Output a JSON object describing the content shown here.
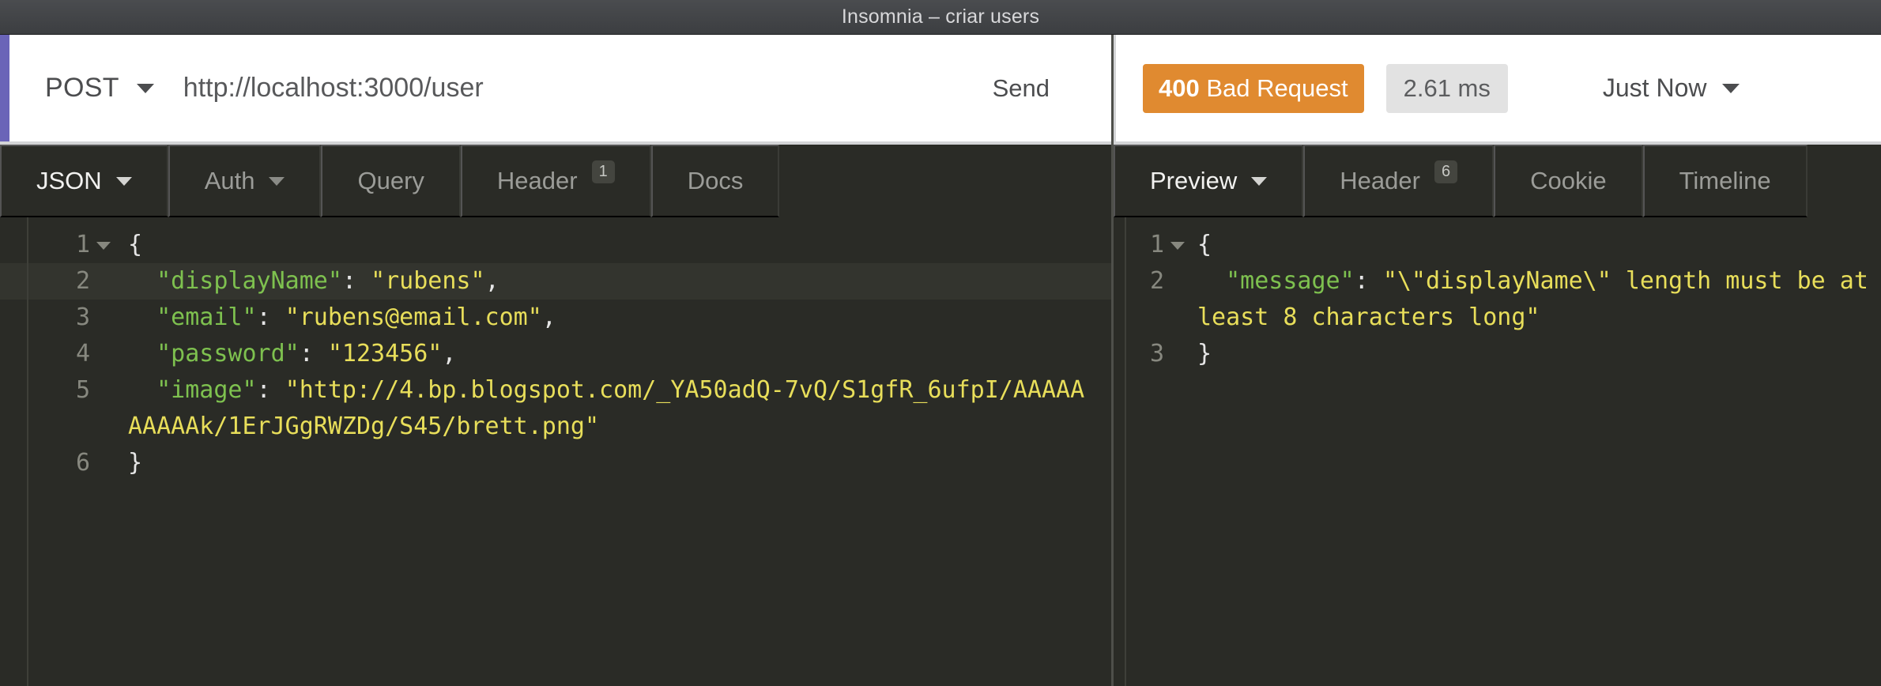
{
  "window": {
    "title": "Insomnia – criar users"
  },
  "colors": {
    "accent_purple": "#6a64b8",
    "status_orange": "#e08a30",
    "editor_background": "#2a2b26",
    "json_key": "#7ec14f",
    "json_string": "#e8de5a",
    "json_punct": "#e6e6e6"
  },
  "request_bar": {
    "method": "POST",
    "method_caret_icon": "chevron-down-icon",
    "url": "http://localhost:3000/user",
    "send_label": "Send"
  },
  "response_bar": {
    "status_code": "400",
    "status_text": " Bad Request",
    "elapsed_time": "2.61 ms",
    "history_label": "Just Now",
    "history_caret_icon": "chevron-down-icon"
  },
  "request_tabs": [
    {
      "label": "JSON",
      "active": true,
      "caret": true,
      "badge": ""
    },
    {
      "label": "Auth",
      "active": false,
      "caret": true,
      "badge": ""
    },
    {
      "label": "Query",
      "active": false,
      "caret": false,
      "badge": ""
    },
    {
      "label": "Header",
      "active": false,
      "caret": false,
      "badge": "1"
    },
    {
      "label": "Docs",
      "active": false,
      "caret": false,
      "badge": ""
    }
  ],
  "response_tabs": [
    {
      "label": "Preview",
      "active": true,
      "caret": true,
      "badge": ""
    },
    {
      "label": "Header",
      "active": false,
      "caret": false,
      "badge": "6"
    },
    {
      "label": "Cookie",
      "active": false,
      "caret": false,
      "badge": ""
    },
    {
      "label": "Timeline",
      "active": false,
      "caret": false,
      "badge": ""
    }
  ],
  "request_body": {
    "lines": [
      {
        "no": "1",
        "fold": true,
        "highlight": false,
        "tokens": [
          {
            "t": "punct",
            "v": "{"
          }
        ]
      },
      {
        "no": "2",
        "fold": false,
        "highlight": true,
        "tokens": [
          {
            "t": "punct",
            "v": "  "
          },
          {
            "t": "key",
            "v": "\"displayName\""
          },
          {
            "t": "punct",
            "v": ": "
          },
          {
            "t": "str",
            "v": "\"rubens\""
          },
          {
            "t": "punct",
            "v": ","
          }
        ]
      },
      {
        "no": "3",
        "fold": false,
        "highlight": false,
        "tokens": [
          {
            "t": "punct",
            "v": "  "
          },
          {
            "t": "key",
            "v": "\"email\""
          },
          {
            "t": "punct",
            "v": ": "
          },
          {
            "t": "str",
            "v": "\"rubens@email.com\""
          },
          {
            "t": "punct",
            "v": ","
          }
        ]
      },
      {
        "no": "4",
        "fold": false,
        "highlight": false,
        "tokens": [
          {
            "t": "punct",
            "v": "  "
          },
          {
            "t": "key",
            "v": "\"password\""
          },
          {
            "t": "punct",
            "v": ": "
          },
          {
            "t": "str",
            "v": "\"123456\""
          },
          {
            "t": "punct",
            "v": ","
          }
        ]
      },
      {
        "no": "5",
        "fold": false,
        "highlight": false,
        "tokens": [
          {
            "t": "punct",
            "v": "  "
          },
          {
            "t": "key",
            "v": "\"image\""
          },
          {
            "t": "punct",
            "v": ": "
          },
          {
            "t": "str",
            "v": "\"http://4.bp.blogspot.com/_YA50adQ-7vQ/S1gfR_6ufpI/AAAAAAAAAAk/1ErJGgRWZDg/S45/brett.png\""
          }
        ]
      },
      {
        "no": "6",
        "fold": false,
        "highlight": false,
        "tokens": [
          {
            "t": "punct",
            "v": "}"
          }
        ]
      }
    ]
  },
  "response_body": {
    "lines": [
      {
        "no": "1",
        "fold": true,
        "highlight": false,
        "tokens": [
          {
            "t": "punct",
            "v": "{"
          }
        ]
      },
      {
        "no": "2",
        "fold": false,
        "highlight": false,
        "tokens": [
          {
            "t": "punct",
            "v": "  "
          },
          {
            "t": "key",
            "v": "\"message\""
          },
          {
            "t": "punct",
            "v": ": "
          },
          {
            "t": "str",
            "v": "\"\\\"displayName\\\" length must be at least 8 characters long\""
          }
        ]
      },
      {
        "no": "3",
        "fold": false,
        "highlight": false,
        "tokens": [
          {
            "t": "punct",
            "v": "}"
          }
        ]
      }
    ]
  }
}
